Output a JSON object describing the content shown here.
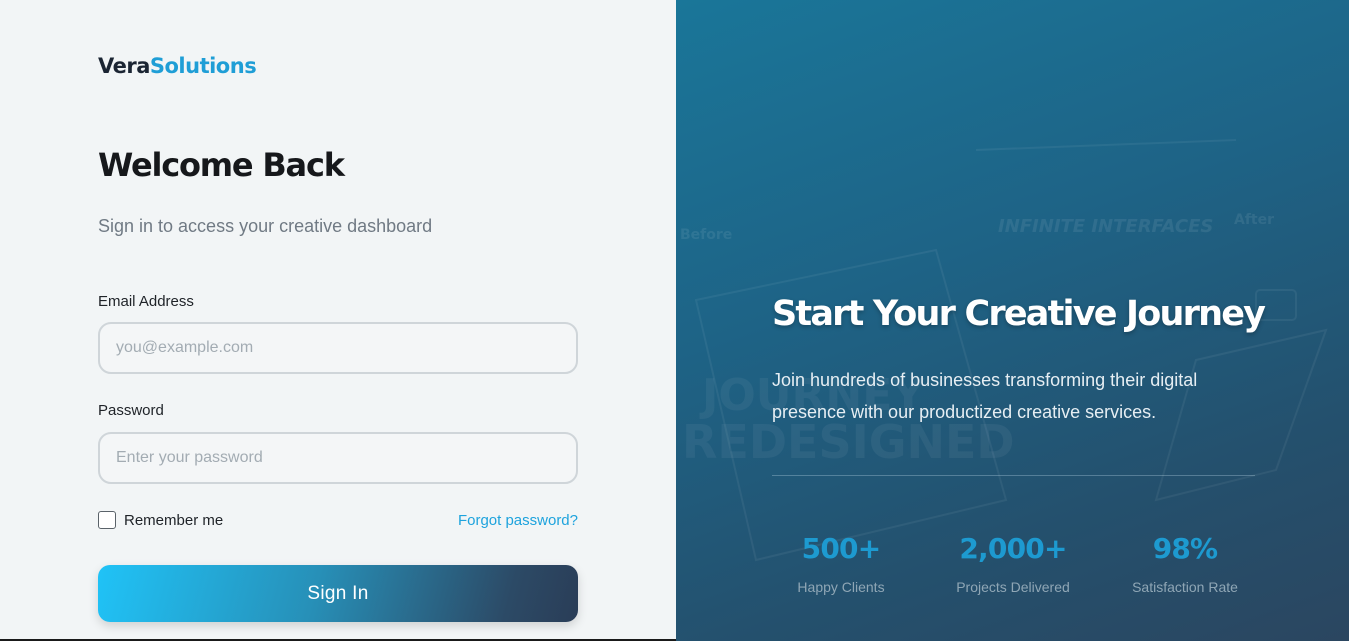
{
  "brand": {
    "part1": "Vera",
    "part2": "Solutions"
  },
  "login": {
    "title": "Welcome Back",
    "subtitle": "Sign in to access your creative dashboard",
    "email_label": "Email Address",
    "email_placeholder": "you@example.com",
    "email_value": "",
    "password_label": "Password",
    "password_placeholder": "Enter your password",
    "password_value": "",
    "remember_label": "Remember me",
    "remember_checked": false,
    "forgot_label": "Forgot password?",
    "signin_label": "Sign In"
  },
  "hero": {
    "title": "Start Your Creative Journey",
    "text": "Join hundreds of businesses transforming their digital presence with our productized creative services.",
    "background_text": {
      "before": "Before",
      "after": "After",
      "banner": "INFINITE INTERFACES",
      "word1": "JOURNEY",
      "word2": "REDESIGNED"
    }
  },
  "stats": [
    {
      "value": "500+",
      "label": "Happy Clients"
    },
    {
      "value": "2,000+",
      "label": "Projects Delivered"
    },
    {
      "value": "98%",
      "label": "Satisfaction Rate"
    }
  ],
  "colors": {
    "brand_accent": "#1f9ed6",
    "link": "#1ea3dd",
    "stat_value": "#1d9ad0",
    "panel_start": "#1a7699",
    "panel_end": "#2b4660"
  }
}
